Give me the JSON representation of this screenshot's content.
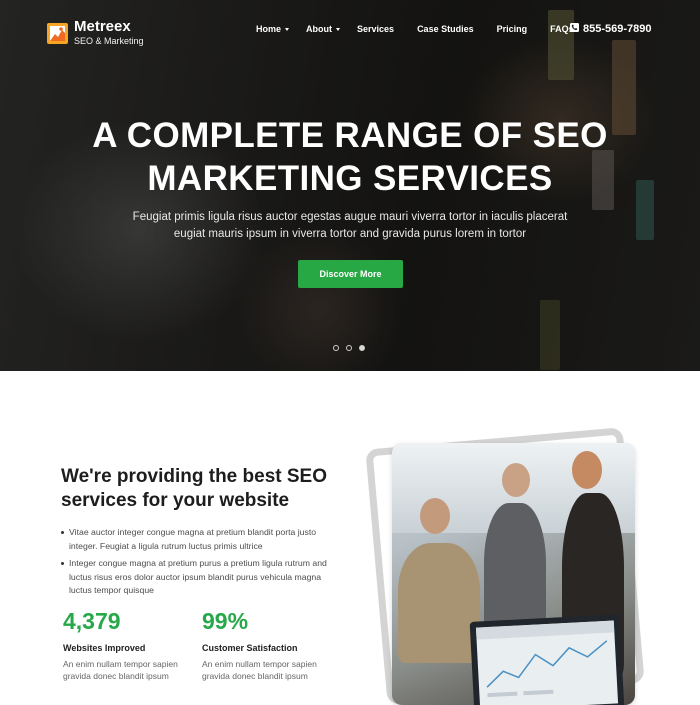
{
  "brand": {
    "name": "Metreex",
    "tagline": "SEO & Marketing",
    "accent": "#28a745"
  },
  "nav": {
    "items": [
      {
        "label": "Home",
        "has_dropdown": true
      },
      {
        "label": "About",
        "has_dropdown": true
      },
      {
        "label": "Services",
        "has_dropdown": false
      },
      {
        "label": "Case Studies",
        "has_dropdown": false
      },
      {
        "label": "Pricing",
        "has_dropdown": false
      },
      {
        "label": "FAQs",
        "has_dropdown": false
      }
    ],
    "phone": "855-569-7890",
    "phone_icon": "phone-icon"
  },
  "hero": {
    "title_line1": "A COMPLETE RANGE OF SEO",
    "title_line2": "MARKETING SERVICES",
    "subtitle_line1": "Feugiat primis ligula risus auctor egestas augue mauri viverra tortor in iaculis placerat",
    "subtitle_line2": "eugiat mauris ipsum in viverra tortor and gravida purus lorem in tortor",
    "cta_label": "Discover More",
    "slider": {
      "count": 3,
      "active": 3
    }
  },
  "about": {
    "title_line1": "We're providing the best SEO",
    "title_line2": "services for your website",
    "bullets": [
      "Vitae auctor integer congue magna at pretium blandit porta justo integer. Feugiat a ligula rutrum luctus primis ultrice",
      "Integer congue magna at pretium purus a pretium ligula rutrum and luctus risus eros dolor auctor ipsum blandit purus vehicula magna luctus tempor quisque"
    ],
    "stats": [
      {
        "value": "4,379",
        "label": "Websites Improved",
        "desc_line1": "An enim nullam tempor sapien",
        "desc_line2": "gravida donec blandit ipsum"
      },
      {
        "value": "99%",
        "label": "Customer Satisfaction",
        "desc_line1": "An enim nullam tempor sapien",
        "desc_line2": "gravida donec blandit ipsum"
      }
    ]
  }
}
